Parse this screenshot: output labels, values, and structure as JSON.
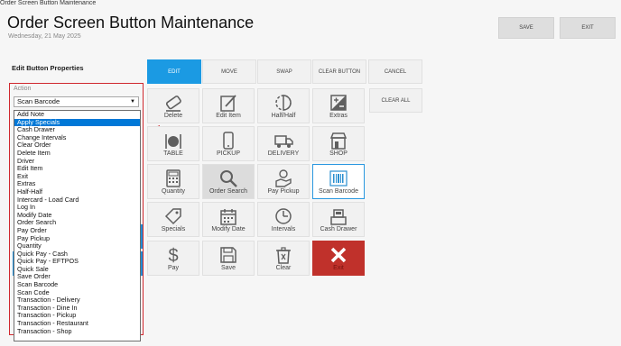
{
  "window": {
    "title": "Order Screen Button Maintenance"
  },
  "header": {
    "title": "Order Screen Button Maintenance",
    "date": "Wednesday, 21 May 2025",
    "save_label": "SAVE",
    "exit_label": "EXIT"
  },
  "panel": {
    "title": "Edit Button Properties",
    "action_label": "Action",
    "selected_value": "Scan Barcode"
  },
  "dropdown": {
    "options": [
      "Add Note",
      "Apply Specials",
      "Cash Drawer",
      "Change Intervals",
      "Clear Order",
      "Delete Item",
      "Driver",
      "Edit Item",
      "Exit",
      "Extras",
      "Half-Half",
      "Intercard - Load Card",
      "Log In",
      "Modify Date",
      "Order Search",
      "Pay Order",
      "Pay Pickup",
      "Quantity",
      "Quick Pay - Cash",
      "Quick Pay - EFTPOS",
      "Quick Sale",
      "Save Order",
      "Scan Barcode",
      "Scan Code",
      "Transaction - Delivery",
      "Transaction - Dine In",
      "Transaction - Pickup",
      "Transaction - Restaurant",
      "Transaction - Shop"
    ],
    "highlighted": "Apply Specials"
  },
  "tabs": [
    "EDIT",
    "MOVE",
    "SWAP",
    "CLEAR BUTTON",
    "CANCEL"
  ],
  "clear_all": "CLEAR ALL",
  "tiles": [
    {
      "label": "Delete",
      "icon": "eraser-icon"
    },
    {
      "label": "Edit Item",
      "icon": "edit-icon"
    },
    {
      "label": "Half/Half",
      "icon": "half-circle-icon"
    },
    {
      "label": "Extras",
      "icon": "plus-minus-icon"
    },
    {
      "label": "TABLE",
      "icon": "cutlery-icon"
    },
    {
      "label": "PICKUP",
      "icon": "phone-icon"
    },
    {
      "label": "DELIVERY",
      "icon": "truck-icon"
    },
    {
      "label": "SHOP",
      "icon": "shop-icon"
    },
    {
      "label": "Quantity",
      "icon": "calculator-icon"
    },
    {
      "label": "Order Search",
      "icon": "search-icon"
    },
    {
      "label": "Pay Pickup",
      "icon": "payment-hand-icon"
    },
    {
      "label": "Scan Barcode",
      "icon": "barcode-icon"
    },
    {
      "label": "Specials",
      "icon": "tag-icon"
    },
    {
      "label": "Modify Date",
      "icon": "calendar-icon"
    },
    {
      "label": "Intervals",
      "icon": "clock-icon"
    },
    {
      "label": "Cash Drawer",
      "icon": "cash-register-icon"
    },
    {
      "label": "Pay",
      "icon": "dollar-icon"
    },
    {
      "label": "Save",
      "icon": "floppy-icon"
    },
    {
      "label": "Clear",
      "icon": "trash-icon"
    },
    {
      "label": "Exit",
      "icon": "close-icon"
    }
  ],
  "colors": {
    "accent": "#1b9ae3",
    "annotation": "#d0282e",
    "exit_tile": "#c0312b",
    "selection": "#0078d7"
  }
}
